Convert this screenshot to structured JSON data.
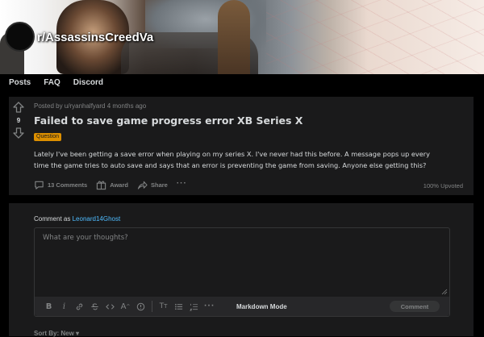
{
  "subreddit": {
    "name": "r/AssassinsCreedValhalla",
    "display_name_visible": "r/AssassinsCreedVa"
  },
  "nav": {
    "items": [
      "Posts",
      "FAQ",
      "Discord"
    ]
  },
  "post": {
    "votes": "9",
    "meta": "Posted by u/ryanhalfyard 4 months ago",
    "title": "Failed to save game progress error XB Series X",
    "flair": "Question",
    "flair_color": "#dc8f00",
    "body": "Lately I've been getting a save error when playing on my series X. I've never had this before. A message pops up every time the game tries to auto save and says that an error is preventing the game from saving. Anyone else getting this?",
    "actions": {
      "comments": "13 Comments",
      "award": "Award",
      "share": "Share",
      "more": "···"
    },
    "upvoted": "100% Upvoted"
  },
  "comment": {
    "comment_as_prefix": "Comment as",
    "username": "Leonard14Ghost",
    "placeholder": "What are your thoughts?",
    "markdown_mode": "Markdown Mode",
    "submit": "Comment",
    "toolbar_icons": [
      "bold-icon",
      "italic-icon",
      "link-icon",
      "strikethrough-icon",
      "inline-code-icon",
      "superscript-icon",
      "spoiler-icon",
      "heading-icon",
      "bulleted-list-icon",
      "numbered-list-icon",
      "more-icon"
    ]
  },
  "sort": {
    "label": "Sort By: New ▾"
  },
  "colors": {
    "background": "#000000",
    "card": "#1a1a1b",
    "text": "#d7dadc",
    "muted": "#818384",
    "link": "#4fbcff"
  }
}
